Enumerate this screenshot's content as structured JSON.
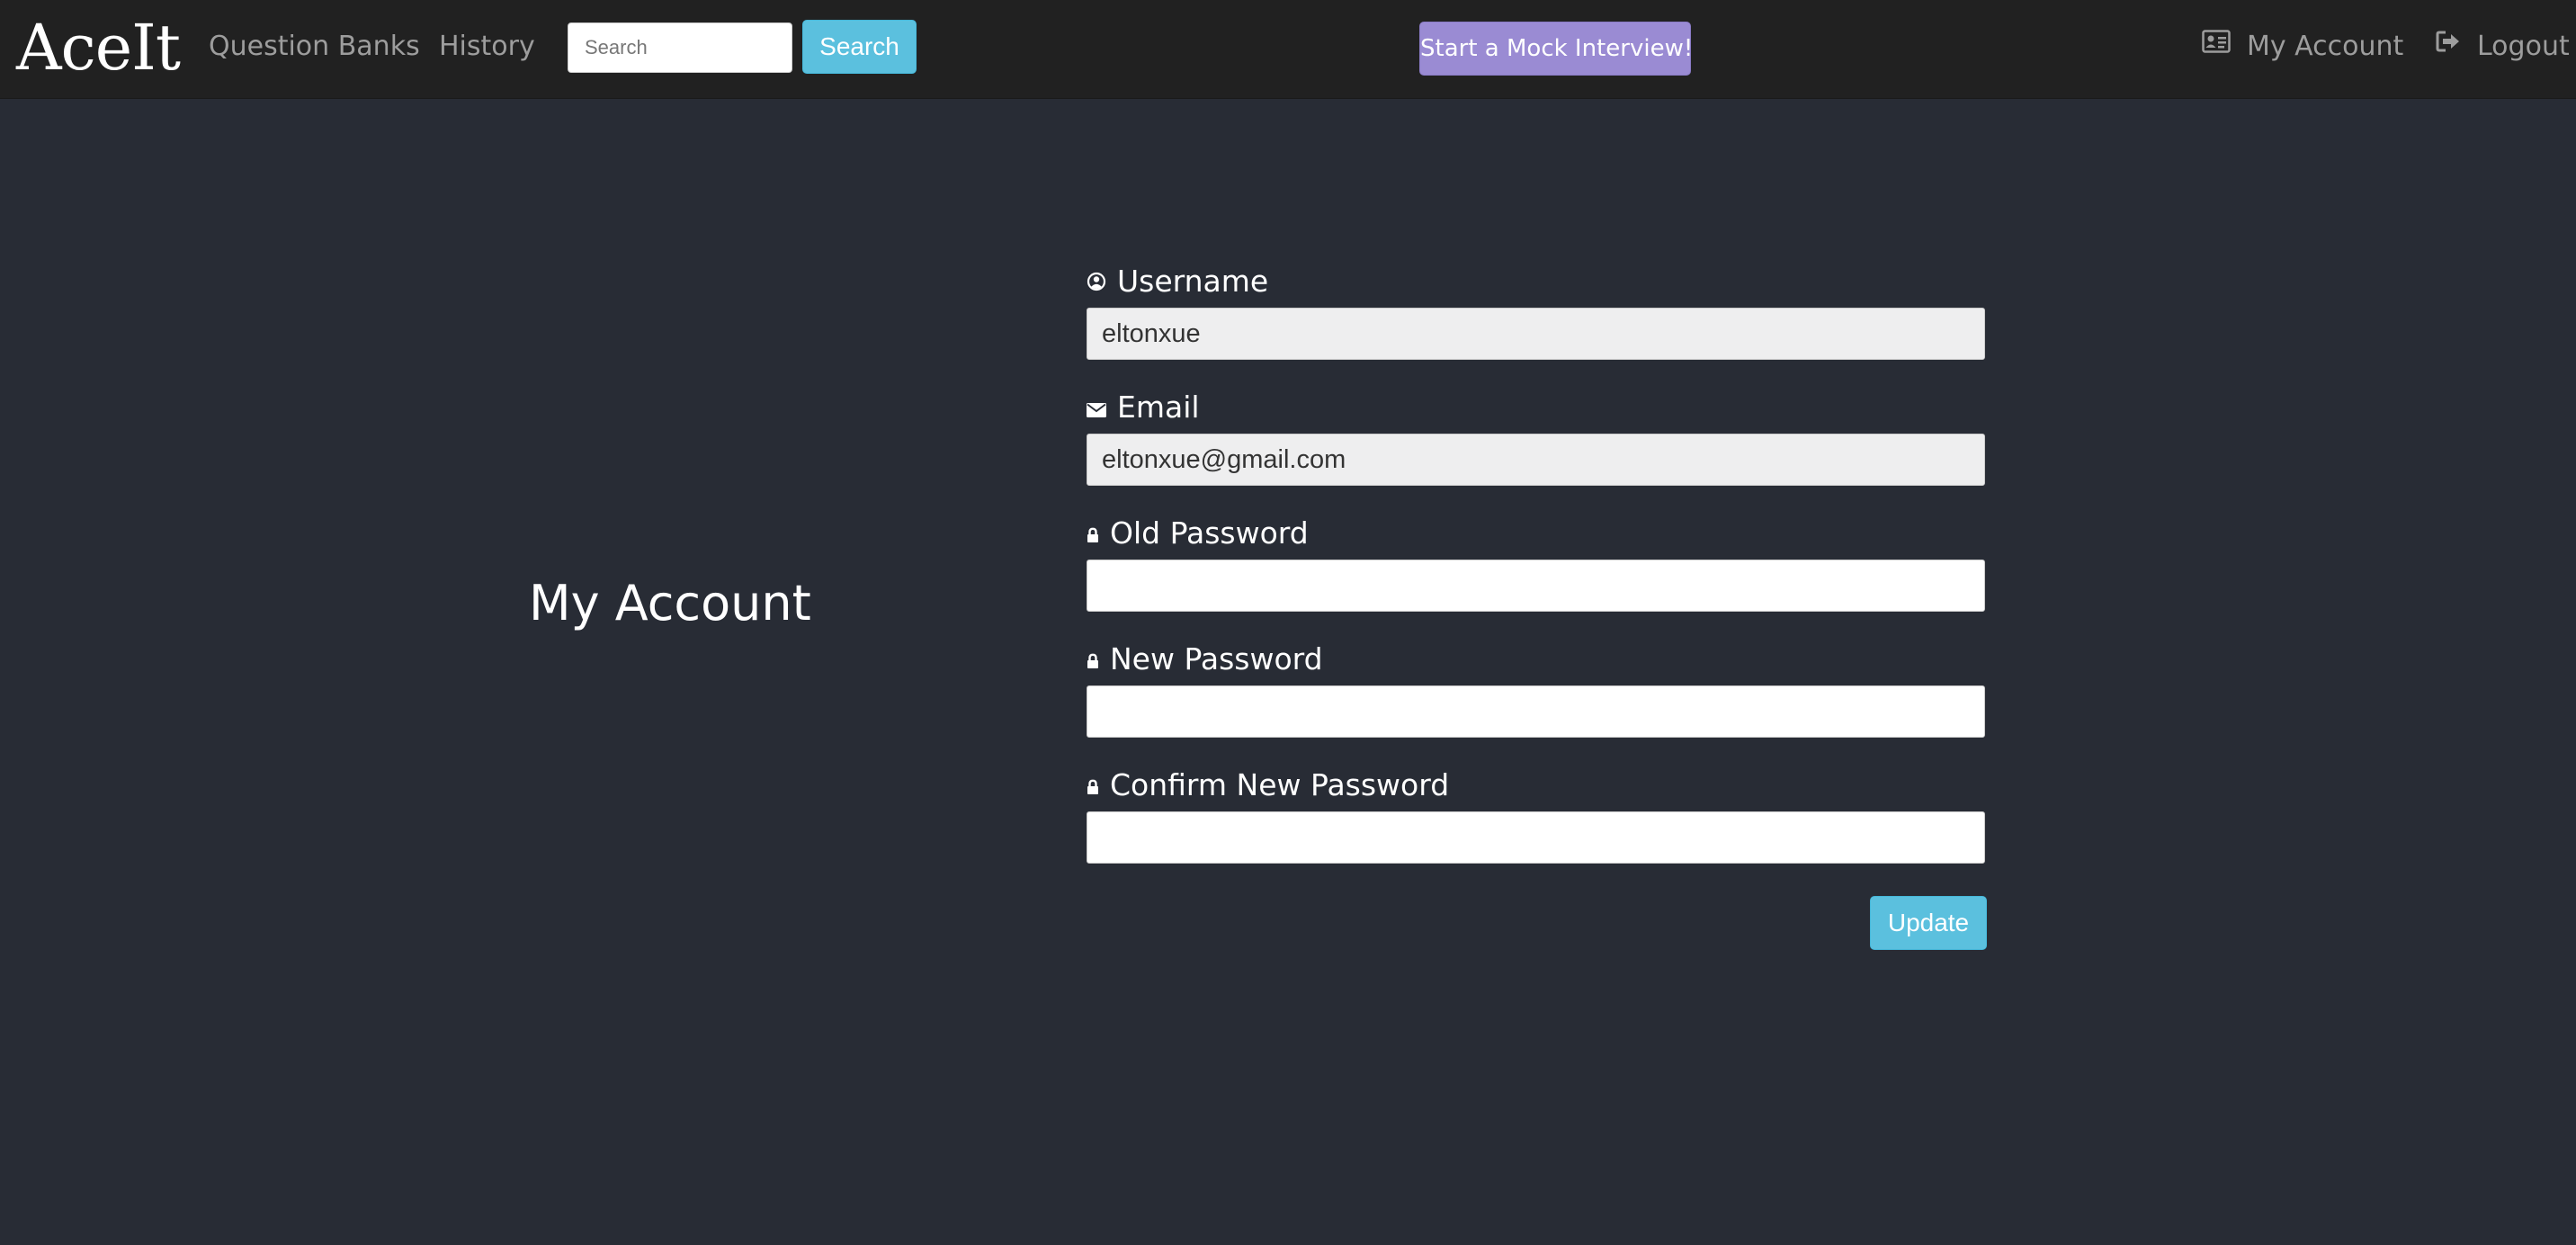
{
  "navbar": {
    "brand": "AceIt",
    "links": {
      "question_banks": "Question Banks",
      "history": "History"
    },
    "search": {
      "placeholder": "Search",
      "button_label": "Search"
    },
    "mock_interview_label": "Start a Mock Interview!",
    "account_label": "My Account",
    "logout_label": "Logout"
  },
  "main": {
    "title": "My Account",
    "form": {
      "username": {
        "label": "Username",
        "value": "eltonxue",
        "icon": "user-circle-icon"
      },
      "email": {
        "label": "Email",
        "value": "eltonxue@gmail.com",
        "icon": "envelope-icon"
      },
      "old_password": {
        "label": "Old Password",
        "value": "",
        "icon": "lock-icon"
      },
      "new_password": {
        "label": "New Password",
        "value": "",
        "icon": "lock-icon"
      },
      "confirm_password": {
        "label": "Confirm New Password",
        "value": "",
        "icon": "lock-icon"
      },
      "submit_label": "Update"
    }
  },
  "colors": {
    "navbar_bg": "#212121",
    "page_bg": "#282c35",
    "info_button": "#5bc0de",
    "mock_button": "#9a8bd3",
    "nav_text": "#9d9d9d"
  }
}
